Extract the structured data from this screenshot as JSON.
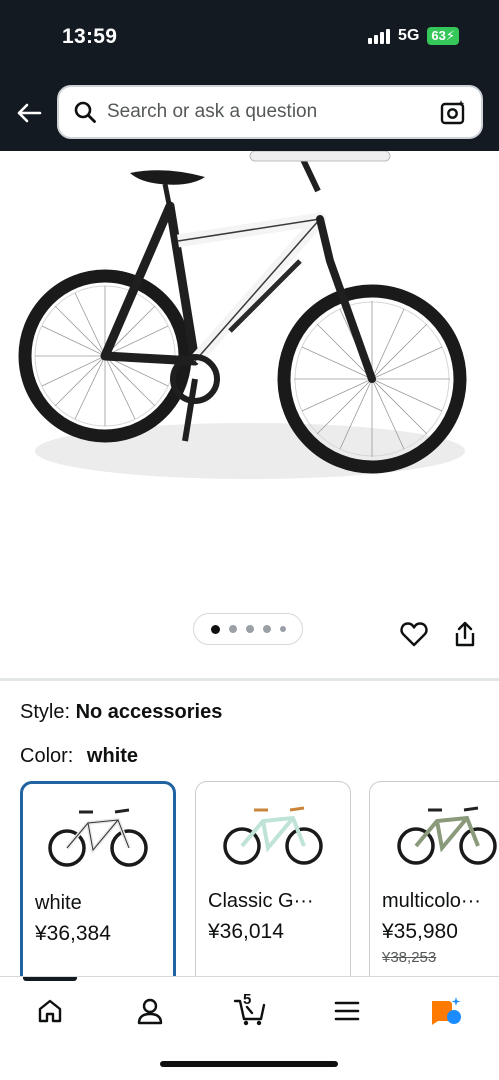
{
  "status_bar": {
    "time": "13:59",
    "network": "5G",
    "battery": "63"
  },
  "search": {
    "placeholder": "Search or ask a question"
  },
  "product": {
    "style_label": "Style:",
    "style_value": "No accessories",
    "color_label": "Color:",
    "color_value": "white"
  },
  "variants": [
    {
      "name": "white",
      "price": "¥36,384",
      "list_price": "",
      "selected": true,
      "frame_color": "#f2f2f2",
      "accent": "#333333"
    },
    {
      "name": "Classic G···",
      "price": "¥36,014",
      "list_price": "",
      "selected": false,
      "frame_color": "#bfe3d6",
      "accent": "#c9853a"
    },
    {
      "name": "multicolo···",
      "price": "¥35,980",
      "list_price": "¥38,253",
      "selected": false,
      "frame_color": "#8a9a7a",
      "accent": "#222222"
    }
  ],
  "bottom_nav": {
    "cart_count": "5"
  },
  "colors": {
    "header": "#131a22",
    "selected_border": "#2162a1",
    "battery": "#35c759"
  }
}
